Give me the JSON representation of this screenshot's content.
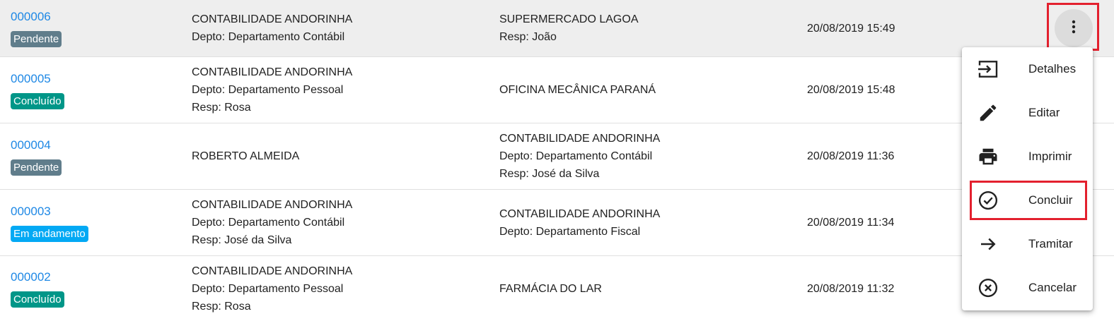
{
  "rows": [
    {
      "protocol": "000006",
      "status": "Pendente",
      "status_color": "#607d8b",
      "origin": [
        "CONTABILIDADE ANDORINHA",
        "Depto: Departamento Contábil"
      ],
      "destination": [
        "SUPERMERCADO LAGOA",
        "Resp: João"
      ],
      "datetime": "20/08/2019 15:49"
    },
    {
      "protocol": "000005",
      "status": "Concluído",
      "status_color": "#009688",
      "origin": [
        "CONTABILIDADE ANDORINHA",
        "Depto: Departamento Pessoal",
        "Resp: Rosa"
      ],
      "destination": [
        "OFICINA MECÂNICA PARANÁ"
      ],
      "datetime": "20/08/2019 15:48"
    },
    {
      "protocol": "000004",
      "status": "Pendente",
      "status_color": "#607d8b",
      "origin": [
        "ROBERTO ALMEIDA"
      ],
      "destination": [
        "CONTABILIDADE ANDORINHA",
        "Depto: Departamento Contábil",
        "Resp: José da Silva"
      ],
      "datetime": "20/08/2019 11:36"
    },
    {
      "protocol": "000003",
      "status": "Em andamento",
      "status_color": "#03a9f4",
      "origin": [
        "CONTABILIDADE ANDORINHA",
        "Depto: Departamento Contábil",
        "Resp: José da Silva"
      ],
      "destination": [
        "CONTABILIDADE ANDORINHA",
        "Depto: Departamento Fiscal"
      ],
      "datetime": "20/08/2019 11:34"
    },
    {
      "protocol": "000002",
      "status": "Concluído",
      "status_color": "#009688",
      "origin": [
        "CONTABILIDADE ANDORINHA",
        "Depto: Departamento Pessoal",
        "Resp: Rosa"
      ],
      "destination": [
        "FARMÁCIA DO LAR"
      ],
      "datetime": "20/08/2019 11:32"
    }
  ],
  "row_menu": {
    "trigger_icon": "more-vert-icon",
    "items": [
      {
        "label": "Detalhes",
        "icon": "login-icon"
      },
      {
        "label": "Editar",
        "icon": "pencil-icon"
      },
      {
        "label": "Imprimir",
        "icon": "printer-icon"
      },
      {
        "label": "Concluir",
        "icon": "check-circle-icon"
      },
      {
        "label": "Tramitar",
        "icon": "arrow-right-icon"
      },
      {
        "label": "Cancelar",
        "icon": "cancel-circle-icon"
      }
    ]
  },
  "colors": {
    "link": "#1e88e5",
    "highlight_border": "#e3202e",
    "selected_row_bg": "#eeeeee"
  }
}
